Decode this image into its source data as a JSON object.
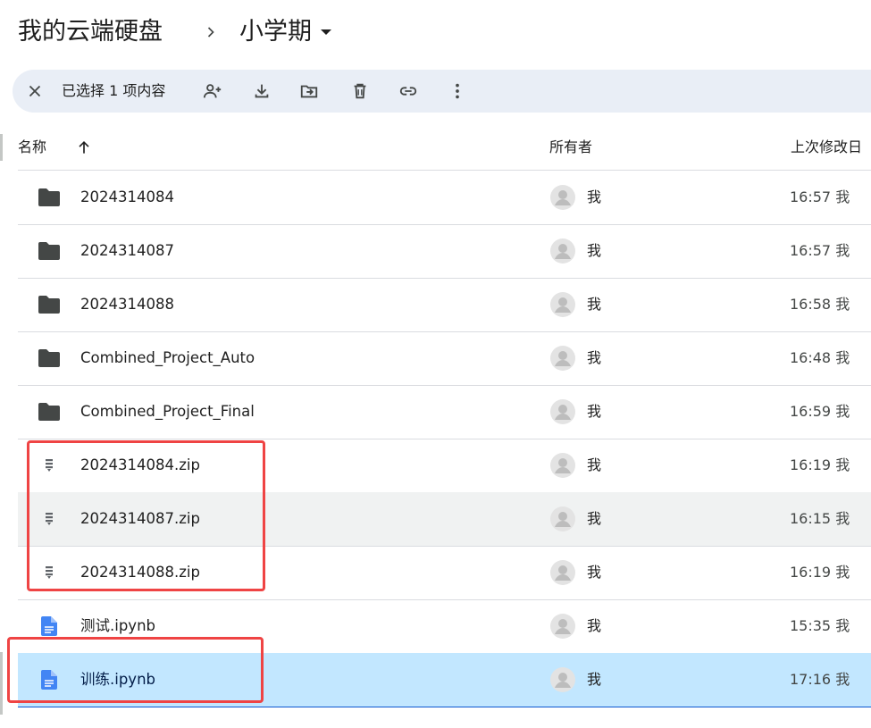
{
  "breadcrumb": {
    "root": "我的云端硬盘",
    "separator_icon": "chevron-right-icon",
    "current": "小学期",
    "current_icon": "caret-down-icon"
  },
  "toolbar": {
    "selection_label": "已选择 1 项内容",
    "icons": [
      "close-icon",
      "share-person-add-icon",
      "download-icon",
      "move-to-folder-icon",
      "trash-icon",
      "link-icon",
      "more-vert-icon"
    ]
  },
  "columns": {
    "name": "名称",
    "sort_icon": "arrow-up-icon",
    "owner": "所有者",
    "modified": "上次修改日"
  },
  "files": [
    {
      "name": "2024314084",
      "type": "folder",
      "owner": "我",
      "modified": "16:57 我"
    },
    {
      "name": "2024314087",
      "type": "folder",
      "owner": "我",
      "modified": "16:57 我"
    },
    {
      "name": "2024314088",
      "type": "folder",
      "owner": "我",
      "modified": "16:58 我"
    },
    {
      "name": "Combined_Project_Auto",
      "type": "folder",
      "owner": "我",
      "modified": "16:48 我"
    },
    {
      "name": "Combined_Project_Final",
      "type": "folder",
      "owner": "我",
      "modified": "16:59 我"
    },
    {
      "name": "2024314084.zip",
      "type": "zip",
      "owner": "我",
      "modified": "16:19 我"
    },
    {
      "name": "2024314087.zip",
      "type": "zip",
      "owner": "我",
      "modified": "16:15 我"
    },
    {
      "name": "2024314088.zip",
      "type": "zip",
      "owner": "我",
      "modified": "16:19 我"
    },
    {
      "name": "测试.ipynb",
      "type": "doc",
      "owner": "我",
      "modified": "15:35 我"
    },
    {
      "name": "训练.ipynb",
      "type": "doc",
      "owner": "我",
      "modified": "17:16 我"
    }
  ],
  "colors": {
    "toolbar_bg": "#e9eef6",
    "selected_bg": "#c2e7ff",
    "hover_bg": "#f0f2f2",
    "annotation": "#ef4444",
    "doc_icon": "#4285f4"
  }
}
